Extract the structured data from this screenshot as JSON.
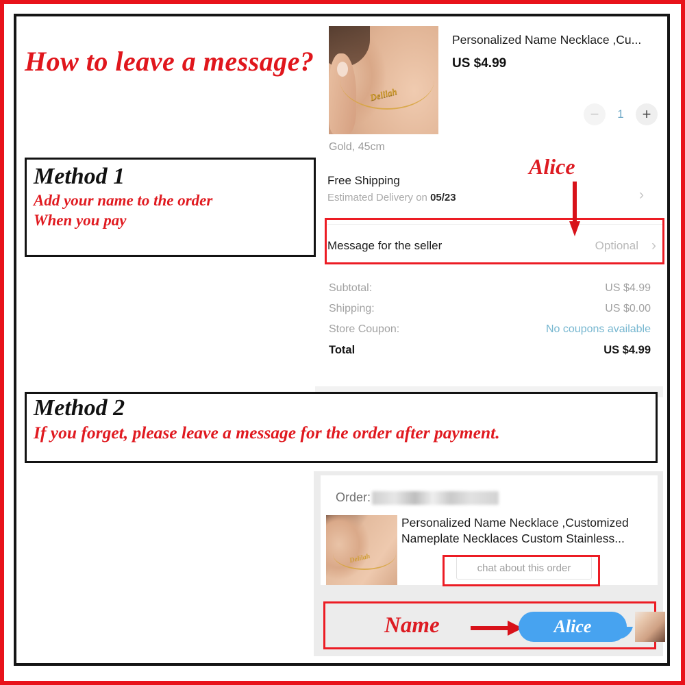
{
  "headline": "How to leave a message?",
  "cart": {
    "product_title": "Personalized Name Necklace ,Cu...",
    "product_price": "US $4.99",
    "product_image_name": "Delilah",
    "quantity": {
      "minus_label": "−",
      "value": "1",
      "plus_label": "+"
    },
    "variant": "Gold, 45cm",
    "shipping": {
      "title": "Free Shipping",
      "sub_prefix": "Estimated Delivery on ",
      "sub_date": "05/23",
      "chevron": "›"
    },
    "message_row": {
      "label": "Message for the seller",
      "placeholder": "Optional",
      "chevron": "›"
    },
    "summary": [
      {
        "label": "Subtotal:",
        "value": "US $4.99",
        "link": false
      },
      {
        "label": "Shipping:",
        "value": "US $0.00",
        "link": false
      },
      {
        "label": "Store Coupon:",
        "value": "No coupons available",
        "link": true
      },
      {
        "label": "Total",
        "value": "US $4.99",
        "link": false
      }
    ]
  },
  "annotations": {
    "alice_label": "Alice",
    "name_label": "Name"
  },
  "method1": {
    "title": "Method 1",
    "line1": "Add your name to the order",
    "line2": "When you pay"
  },
  "method2": {
    "title": "Method 2",
    "line1": "If you forget, please leave a message for the order after payment."
  },
  "order_panel": {
    "order_label": "Order:",
    "product_title": "Personalized Name Necklace ,Customized Nameplate Necklaces Custom Stainless...",
    "product_image_name": "Delilah",
    "chat_button": "chat about this order"
  },
  "chat": {
    "bubble_text": "Alice"
  },
  "colors": {
    "annotation_red": "#e0161c",
    "box_border_red": "#ec1c24",
    "frame_black": "#151515",
    "bubble_blue": "#47a3f0",
    "link_blue": "#77b7d0"
  }
}
